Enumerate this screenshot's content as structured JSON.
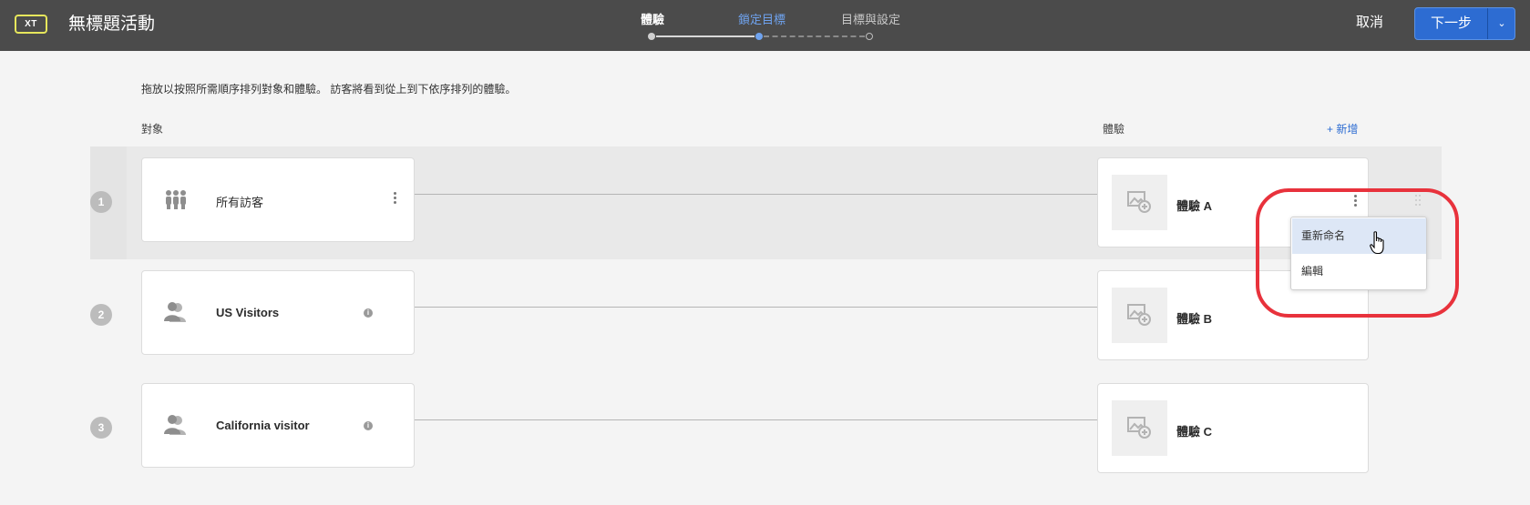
{
  "header": {
    "badge": "XT",
    "title": "無標題活動",
    "steps": [
      {
        "label": "體驗",
        "state": "done"
      },
      {
        "label": "鎖定目標",
        "state": "active"
      },
      {
        "label": "目標與設定",
        "state": "todo"
      }
    ],
    "cancel_label": "取消",
    "next_label": "下一步",
    "next_caret": "⌄"
  },
  "main": {
    "instruction": "拖放以按照所需順序排列對象和體驗。 訪客將看到從上到下依序排列的體驗。",
    "audience_header": "對象",
    "experience_header": "體驗",
    "add_label": "+ 新增"
  },
  "rows": [
    {
      "number": "1",
      "audience": "所有訪客",
      "audience_icon": "all-visitors-icon",
      "experience": "體驗 A"
    },
    {
      "number": "2",
      "audience": "US Visitors",
      "audience_icon": "audience-icon",
      "experience": "體驗 B"
    },
    {
      "number": "3",
      "audience": "California visitor",
      "audience_icon": "audience-icon",
      "experience": "體驗 C"
    }
  ],
  "context_menu": {
    "items": [
      "重新命名",
      "編輯"
    ]
  },
  "colors": {
    "topbar": "#4b4b4b",
    "accent": "#2d6cd2",
    "active_step": "#6fa3ef",
    "callout": "#e8323c"
  }
}
